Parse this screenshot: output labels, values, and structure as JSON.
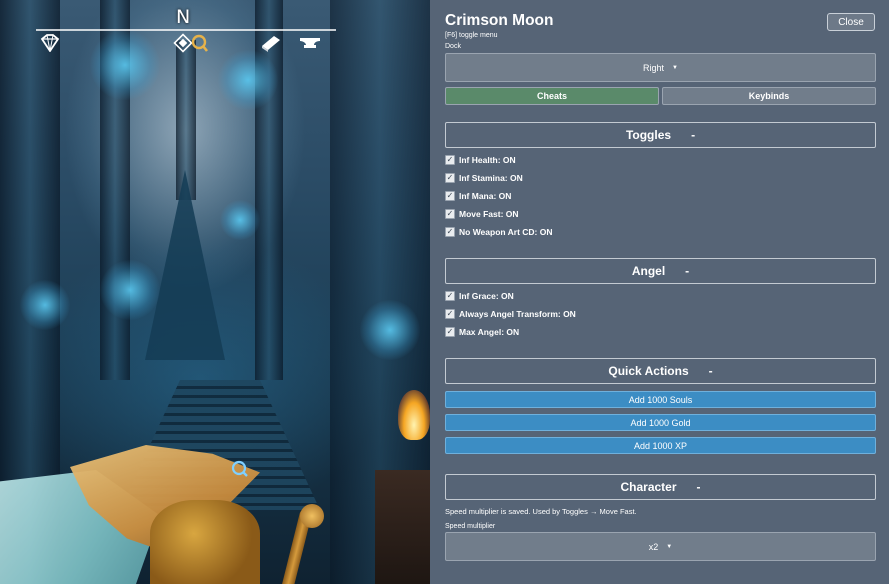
{
  "hud": {
    "compass_heading": "N",
    "icons": [
      "crystal-shard-icon",
      "map-fragment-icon",
      "book-icon",
      "anvil-icon"
    ]
  },
  "panel": {
    "title": "Crimson Moon",
    "close_label": "Close",
    "toggle_hint": "[F6] toggle menu",
    "dock_label": "Dock",
    "dock_value": "Right",
    "tabs": [
      {
        "label": "Cheats",
        "active": true
      },
      {
        "label": "Keybinds",
        "active": false
      }
    ]
  },
  "sections": {
    "toggles": {
      "title": "Toggles",
      "collapse_symbol": "-",
      "items": [
        {
          "label": "Inf Health: ON",
          "checked": true
        },
        {
          "label": "Inf Stamina: ON",
          "checked": true
        },
        {
          "label": "Inf Mana: ON",
          "checked": true
        },
        {
          "label": "Move Fast: ON",
          "checked": true
        },
        {
          "label": "No Weapon Art CD: ON",
          "checked": true
        }
      ]
    },
    "angel": {
      "title": "Angel",
      "collapse_symbol": "-",
      "items": [
        {
          "label": "Inf Grace: ON",
          "checked": true
        },
        {
          "label": "Always Angel Transform: ON",
          "checked": true
        },
        {
          "label": "Max Angel: ON",
          "checked": true
        }
      ]
    },
    "quick_actions": {
      "title": "Quick Actions",
      "collapse_symbol": "-",
      "buttons": [
        "Add 1000 Souls",
        "Add 1000 Gold",
        "Add 1000 XP"
      ]
    },
    "character": {
      "title": "Character",
      "collapse_symbol": "-",
      "note": "Speed multiplier is saved. Used by Toggles → Move Fast.",
      "speed_label": "Speed multiplier",
      "speed_value": "x2"
    }
  },
  "colors": {
    "panel_bg": "#566476",
    "active_tab": "#5a8a6a",
    "action_button": "#3c8dc4"
  }
}
